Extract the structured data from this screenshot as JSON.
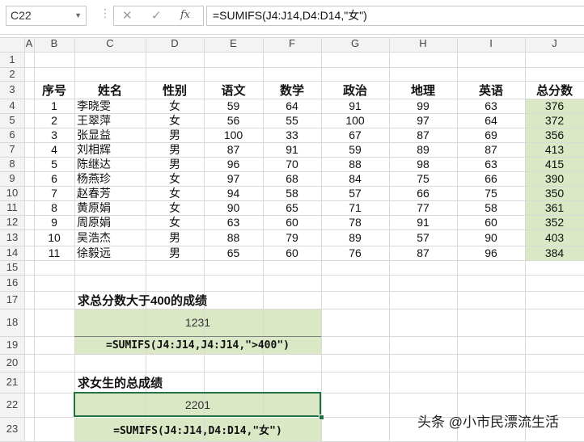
{
  "name_box": "C22",
  "formula_bar": {
    "cancel_icon": "✕",
    "enter_icon": "✓",
    "fx_label": "fx",
    "formula": "=SUMIFS(J4:J14,D4:D14,\"女\")"
  },
  "columns": [
    "A",
    "B",
    "C",
    "D",
    "E",
    "F",
    "G",
    "H",
    "I",
    "J"
  ],
  "rows": [
    "1",
    "2",
    "3",
    "4",
    "5",
    "6",
    "7",
    "8",
    "9",
    "10",
    "11",
    "12",
    "13",
    "14",
    "15",
    "16",
    "17",
    "18",
    "19",
    "20",
    "21",
    "22",
    "23"
  ],
  "table": {
    "headers": [
      "序号",
      "姓名",
      "性别",
      "语文",
      "数学",
      "政治",
      "地理",
      "英语",
      "总分数"
    ],
    "rows": [
      [
        "1",
        "李晓雯",
        "女",
        "59",
        "64",
        "91",
        "99",
        "63",
        "376"
      ],
      [
        "2",
        "王翠萍",
        "女",
        "56",
        "55",
        "100",
        "97",
        "64",
        "372"
      ],
      [
        "3",
        "张显益",
        "男",
        "100",
        "33",
        "67",
        "87",
        "69",
        "356"
      ],
      [
        "4",
        "刘相辉",
        "男",
        "87",
        "91",
        "59",
        "89",
        "87",
        "413"
      ],
      [
        "5",
        "陈继达",
        "男",
        "96",
        "70",
        "88",
        "98",
        "63",
        "415"
      ],
      [
        "6",
        "杨燕珍",
        "女",
        "97",
        "68",
        "84",
        "75",
        "66",
        "390"
      ],
      [
        "7",
        "赵春芳",
        "女",
        "94",
        "58",
        "57",
        "66",
        "75",
        "350"
      ],
      [
        "8",
        "黄原娟",
        "女",
        "90",
        "65",
        "71",
        "77",
        "58",
        "361"
      ],
      [
        "9",
        "周原娟",
        "女",
        "63",
        "60",
        "78",
        "91",
        "60",
        "352"
      ],
      [
        "10",
        "吴浩杰",
        "男",
        "88",
        "79",
        "89",
        "57",
        "90",
        "403"
      ],
      [
        "11",
        "徐毅远",
        "男",
        "65",
        "60",
        "76",
        "87",
        "96",
        "384"
      ]
    ]
  },
  "block1": {
    "title": "求总分数大于400的成绩",
    "result": "1231",
    "formula": "=SUMIFS(J4:J14,J4:J14,\">400\")"
  },
  "block2": {
    "title": "求女生的总成绩",
    "result": "2201",
    "formula": "=SUMIFS(J4:J14,D4:D14,\"女\")"
  },
  "watermark": "头条 @小市民漂流生活",
  "colors": {
    "green": "#dbe8c6",
    "selection": "#217346"
  }
}
